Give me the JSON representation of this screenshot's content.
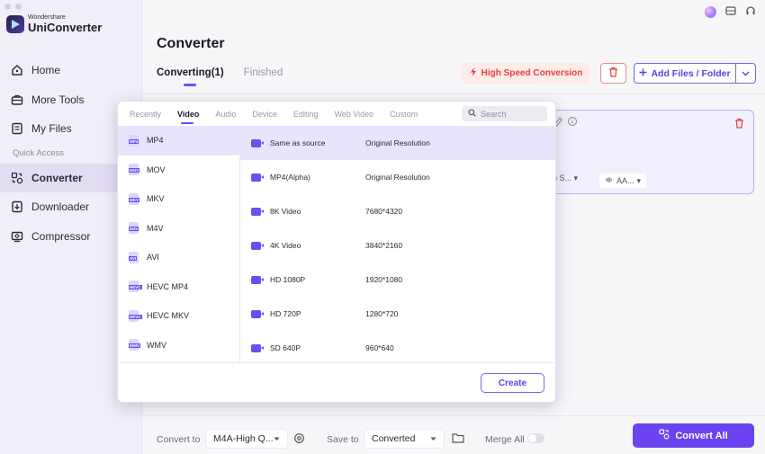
{
  "app": {
    "brand": "Wondershare",
    "product": "UniConverter"
  },
  "sidebar": {
    "items": [
      {
        "label": "Home",
        "icon": "home-icon"
      },
      {
        "label": "More Tools",
        "icon": "toolbox-icon"
      },
      {
        "label": "My Files",
        "icon": "files-icon"
      }
    ],
    "section_label": "Quick Access",
    "quick_items": [
      {
        "label": "Converter",
        "icon": "converter-icon",
        "active": true
      },
      {
        "label": "Downloader",
        "icon": "download-icon"
      },
      {
        "label": "Compressor",
        "icon": "compress-icon"
      }
    ]
  },
  "header": {
    "title": "Converter",
    "tabs": [
      {
        "label": "Converting(1)",
        "active": true
      },
      {
        "label": "Finished"
      }
    ],
    "high_speed_label": "High Speed Conversion",
    "add_files_label": "Add Files / Folder"
  },
  "file_card": {
    "chip1": "o S...",
    "chip2": "AA..."
  },
  "popup": {
    "category_tabs": [
      "Recently",
      "Video",
      "Audio",
      "Device",
      "Editing",
      "Web Video",
      "Custom"
    ],
    "active_category": "Video",
    "search_placeholder": "Search",
    "formats": [
      {
        "label": "MP4",
        "tag": "MP4"
      },
      {
        "label": "MOV",
        "tag": "MOV"
      },
      {
        "label": "MKV",
        "tag": "MKV"
      },
      {
        "label": "M4V",
        "tag": "M4V"
      },
      {
        "label": "AVI",
        "tag": "AVI"
      },
      {
        "label": "HEVC MP4",
        "tag": "HEVC"
      },
      {
        "label": "HEVC MKV",
        "tag": "HEVC"
      },
      {
        "label": "WMV",
        "tag": "WMV"
      }
    ],
    "resolutions": [
      {
        "name": "Same as source",
        "value": "Original Resolution"
      },
      {
        "name": "MP4(Alpha)",
        "value": "Original Resolution"
      },
      {
        "name": "8K Video",
        "value": "7680*4320"
      },
      {
        "name": "4K Video",
        "value": "3840*2160"
      },
      {
        "name": "HD 1080P",
        "value": "1920*1080"
      },
      {
        "name": "HD 720P",
        "value": "1280*720"
      },
      {
        "name": "SD 640P",
        "value": "960*640"
      }
    ],
    "create_label": "Create"
  },
  "bottom_bar": {
    "convert_to_label": "Convert to",
    "convert_to_value": "M4A-High Q...",
    "save_to_label": "Save to",
    "save_to_value": "Converted",
    "merge_all_label": "Merge All",
    "convert_all_label": "Convert All"
  },
  "colors": {
    "accent": "#6b43f0",
    "danger": "#e5413a",
    "selection": "#e9e4fb"
  }
}
